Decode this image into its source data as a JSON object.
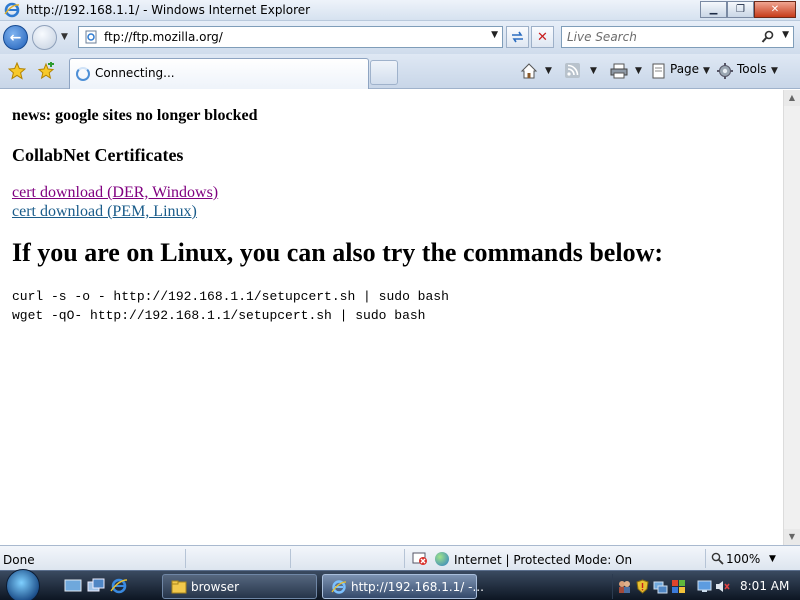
{
  "window": {
    "title": "http://192.168.1.1/ - Windows Internet Explorer",
    "minimize_glyph": "▁",
    "maximize_glyph": "❐",
    "close_glyph": "✕"
  },
  "address_bar": {
    "url": "ftp://ftp.mozilla.org/",
    "search_placeholder": "Live Search"
  },
  "tab": {
    "label": "Connecting..."
  },
  "command_bar": {
    "page_label": "Page",
    "tools_label": "Tools"
  },
  "content": {
    "news": "news: google sites no longer blocked",
    "certs_heading": "CollabNet Certificates",
    "links": [
      "cert download (DER, Windows)",
      "cert download (PEM, Linux)"
    ],
    "linux_heading": "If you are on Linux, you can also try the commands below:",
    "commands": [
      "curl -s -o - http://192.168.1.1/setupcert.sh | sudo bash",
      "wget -qO- http://192.168.1.1/setupcert.sh | sudo bash"
    ]
  },
  "status_bar": {
    "status": "Done",
    "zone": "Internet | Protected Mode: On",
    "zoom": "100%"
  },
  "taskbar": {
    "buttons": [
      "browser",
      "http://192.168.1.1/ -..."
    ],
    "clock": "8:01 AM"
  },
  "colors": {
    "visited_link": "#800080",
    "link": "#1a5c8a"
  }
}
